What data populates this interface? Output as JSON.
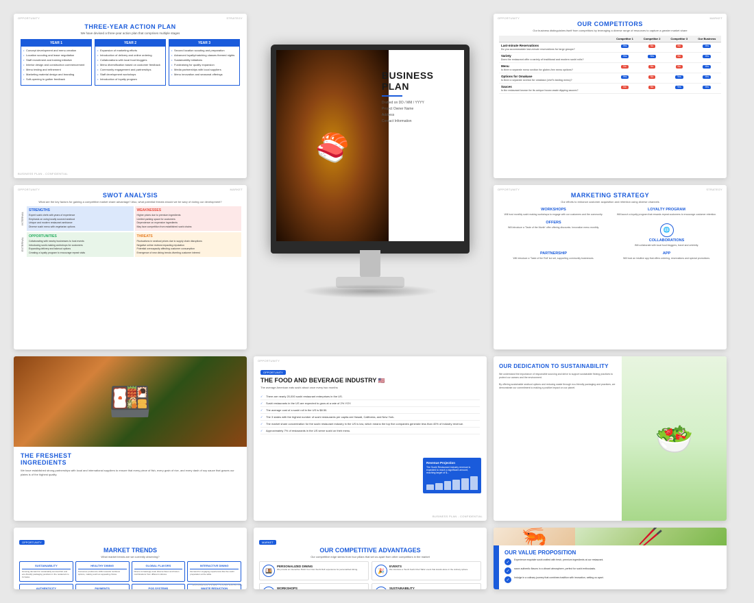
{
  "slides": {
    "slide1": {
      "corner_tl": "OPPORTUNITY",
      "corner_tr": "STRATEGY",
      "title": "THREE-YEAR ACTION PLAN",
      "subtitle": "We have devised a three-year action plan that comprises multiple stages",
      "years": [
        {
          "label": "YEAR 1",
          "items": [
            "Concept development and menu creation",
            "Location scouting and lease negotiation",
            "Staff recruitment and training initiative",
            "Interior design and construction commencement",
            "Menu testing and refinement",
            "Marketing material design and branding",
            "Soft-opening to gather feedback"
          ]
        },
        {
          "label": "YEAR 2",
          "items": [
            "Expansion of marketing efforts",
            "Introduction of delivery and online ordering",
            "Collaborations with local food bloggers",
            "Menu diversification based on customer feedback",
            "Community engagement and partnerships",
            "Staff development workshops",
            "Introduction of loyalty program"
          ]
        },
        {
          "label": "YEAR 3",
          "items": [
            "Second location scouting and preparation",
            "Advanced loyalty/matching classes themed nights",
            "Sustainability initiatives",
            "Fundraising for quality expansion",
            "Media partnerships with local suppliers",
            "Menu innovation and seasonal offerings"
          ]
        }
      ]
    },
    "slide2": {
      "corner_tl": "OPPORTUNITY",
      "corner_tr": "MARKET",
      "title": "OUR COMPETITORS",
      "subtitle": "Our business distinguishes itself from competitors by leveraging a diverse range of resources to capture a greater market share",
      "columns": [
        "Competitor 1",
        "Competitor 2",
        "Competitor 3",
        "Our Business"
      ],
      "rows": [
        {
          "feature": "Last-minute Reservations",
          "description": "Do you accommodate last-minute reservations for large groups?",
          "vals": [
            "Yes",
            "No",
            "No",
            "Yes"
          ]
        },
        {
          "feature": "Variety",
          "description": "Does the restaurant offer a variety of traditional and modern sushi rolls?",
          "vals": [
            "Yes",
            "Yes",
            "No",
            "Yes"
          ]
        },
        {
          "feature": "Menu",
          "description": "Is there a separate menu section for gluten-free menu options?",
          "vals": [
            "No",
            "No",
            "No",
            "Yes"
          ]
        },
        {
          "feature": "Options for Omakase",
          "description": "Is there a separate section for omakase (chef's tasting menu)?",
          "vals": [
            "Yes",
            "No",
            "Yes",
            "Yes"
          ]
        },
        {
          "feature": "Sauces",
          "description": "Is the restaurant known for its unique house-made dipping sauces?",
          "vals": [
            "No",
            "No",
            "Yes",
            "Yes"
          ]
        }
      ]
    },
    "slide3": {
      "corner_tl": "OPPORTUNITY",
      "corner_tr": "MARKET",
      "title": "SWOT ANALYSIS",
      "subtitle": "What are the key factors for gaining a competitive market share advantage? Also, what potential threats should we be wary of during our development?",
      "strengths": {
        "label": "STRENGTHS",
        "items": [
          "Expert sushi chefs with years of experience",
          "Emphasis on using locally sourced seafood",
          "Unique and modern restaurant ambiance",
          "Diverse sushi menu with vegetarian options"
        ]
      },
      "weaknesses": {
        "label": "WEAKNESSES",
        "items": [
          "Higher prices due to premium ingredients",
          "Limited parking space for customers",
          "Dependence on expensive ingredients",
          "May face competition from established sushi chains"
        ]
      },
      "opportunities": {
        "label": "OPPORTUNITIES",
        "items": [
          "Collaborating with nearby businesses to host events",
          "Introducing sushi-making workshops for customers",
          "Expanding delivery and takeout options",
          "Creating a loyalty program to encourage repeat visits"
        ]
      },
      "threats": {
        "label": "THREATS",
        "items": [
          "Fluctuations in seafood prices due to supply chain disruptions",
          "Negative online reviews impacting reputation",
          "Potential overcapacity affecting customer consumption",
          "Emergence of new dining trends diverting customer interest"
        ]
      },
      "axis_internal": "INTERNAL",
      "axis_external": "EXTERNAL"
    },
    "slide4": {
      "corner_tl": "OPPORTUNITY",
      "corner_tr": "STRATEGY",
      "title": "MARKETING STRATEGY",
      "subtitle": "Our efforts to enhance customer acquisition and retention using diverse channels",
      "items": [
        {
          "title": "WORKSHOPS",
          "text": "Will host monthly sushi making workshops to engage with our customers and the community."
        },
        {
          "title": "LOYALTY PROGRAM",
          "text": "Will launch a loyalty program that rewards repeat customers to encourage customer retention."
        },
        {
          "title": "OFFERS",
          "text": "Will introduce a 'Taste of the Month' offer offering discounts. Innovation menu monthly."
        },
        {
          "title": "COLLABORATIONS",
          "text": "Will collaborate with local food bloggers, travel and celebrity."
        },
        {
          "title": "PARTNERSHIP",
          "text": "Will introduce a 'Taste of the Roll' koi set, supporting community businesses."
        },
        {
          "title": "APP",
          "text": "Will host an intuitive app that offers ordering, reservations and special promotions."
        }
      ]
    },
    "slide5": {
      "business": "BUSINESS",
      "plan": "PLAN",
      "drafted": "Drafted on DD / MM / YYYY",
      "project": "Project Owner Name",
      "address": "Address",
      "contact": "Contact Information"
    },
    "slide6": {
      "title": "THE FRESHEST",
      "title2": "INGREDIENTS",
      "text": "We have established strong partnerships with local and international suppliers to ensure that every piece of fish, every grain of rice, and every dash of soy sauce that graces our plates is of the highest quality."
    },
    "slide7": {
      "corner_tl": "OPPORTUNITY",
      "corner_br": "BUSINESS PLAN - CONFIDENTIAL",
      "tag": "OPPORTUNITY",
      "title": "THE FOOD AND BEVERAGE INDUSTRY",
      "flag": "🇺🇸",
      "subtitle": "The average American eats sushi about once every two months",
      "stats": [
        "There are nearly 20,000 sushi restaurant enterprises in the US.",
        "Sushi restaurants in the US are expected to grow at a rate of 2% YOY.",
        "The average cost of a sushi roll in the US is $8.50.",
        "The 3 states with the highest number of sushi restaurants per capita are Hawaii, California, and New York.",
        "The market share concentration for the sushi restaurant industry in the US is low, which means the top five companies generate less than 40% of industry revenue.",
        "Approximately 7% of restaurants in the US serve sushi on their menu."
      ],
      "revenue_title": "Revenue for the Sushi Restaurant industry is expected to reach this amount in the next few years, reaching 130 million target of 8..."
    },
    "slide8": {
      "title": "OUR DEDICATION TO SUSTAINABILITY",
      "text1": "We understand the importance of responsible sourcing and strive to support sustainable fishing practices to protect our oceans and the environment.",
      "text2": "By offering sustainable seafood options and reducing waste through eco-friendly packaging and practices, we demonstrate our commitment to making a positive impact on our planet."
    },
    "slide9": {
      "tag": "OPPORTUNITY",
      "title": "MARKET TRENDS",
      "subtitle": "What market trends are we currently observing?",
      "trends": [
        {
          "title": "SUSTAINABILITY",
          "text": "Growing demand for sustainably-sourced fish and eco-friendly packaging positions in the restaurant to increase."
        },
        {
          "title": "HEALTHY DINING",
          "text": "Consumer preference shifts towards nutritious options, making sushi an appealing choice."
        },
        {
          "title": "GLOBAL FLAVORS",
          "text": "Diners increasingly seek diverse flavor and fusion combinations from different cultures."
        },
        {
          "title": "INTERACTIVE DINING",
          "text": "Demand for engaging experiences like live sushi preparation at the table."
        },
        {
          "title": "AUTHENTICITY",
          "text": "Customers value sushi quality and preparation techniques, showcasing restaurant practices, menu items and ingredients."
        },
        {
          "title": "PAYMENTS",
          "text": "Diners seek digital and mobile integrated payment options and secure restaurant payment options."
        },
        {
          "title": "POS SYSTEMS",
          "text": "Modern POS solutions for efficient billing, table management, and inventory management."
        },
        {
          "title": "WASTE REDUCTION",
          "text": "Innovative solutions to minimize food waste and composting."
        }
      ]
    },
    "slide10": {
      "tag": "MARKET",
      "title": "OUR COMPETITIVE ADVANTAGES",
      "subtitle": "Our competitive edge stems from four pillars that set us apart from other competitors in the market",
      "advantages": [
        {
          "icon": "🍱",
          "title": "PERSONALIZED DINING",
          "text": "We provide an interactive 'Build Your Own Sushi Roll' experience for personalized dining."
        },
        {
          "icon": "🎉",
          "title": "EVENTS",
          "text": "We introduce a 'Sushi Sushi Chef Table' event that stands alone in the culinary sphere."
        },
        {
          "icon": "🍴",
          "title": "WORKSHOPS",
          "text": "Hosting / selling customers for their Roll with chef staffing."
        },
        {
          "icon": "♻️",
          "title": "SUSTAINABILITY",
          "text": "Pledge / championing our sustainable seafood, sourcing and our overall sustainability journey."
        }
      ]
    },
    "slide11": {
      "title": "OUR VALUE PROPOSITION",
      "values": [
        "Experience exquisite sushi crafted with fresh, premium ingredients at our restaurant.",
        "savor authentic flavors in a vibrant atmosphere, perfect for sushi enthusiasts.",
        "Indulge in a culinary journey that combines tradition with innovation, setting us apart."
      ]
    }
  }
}
